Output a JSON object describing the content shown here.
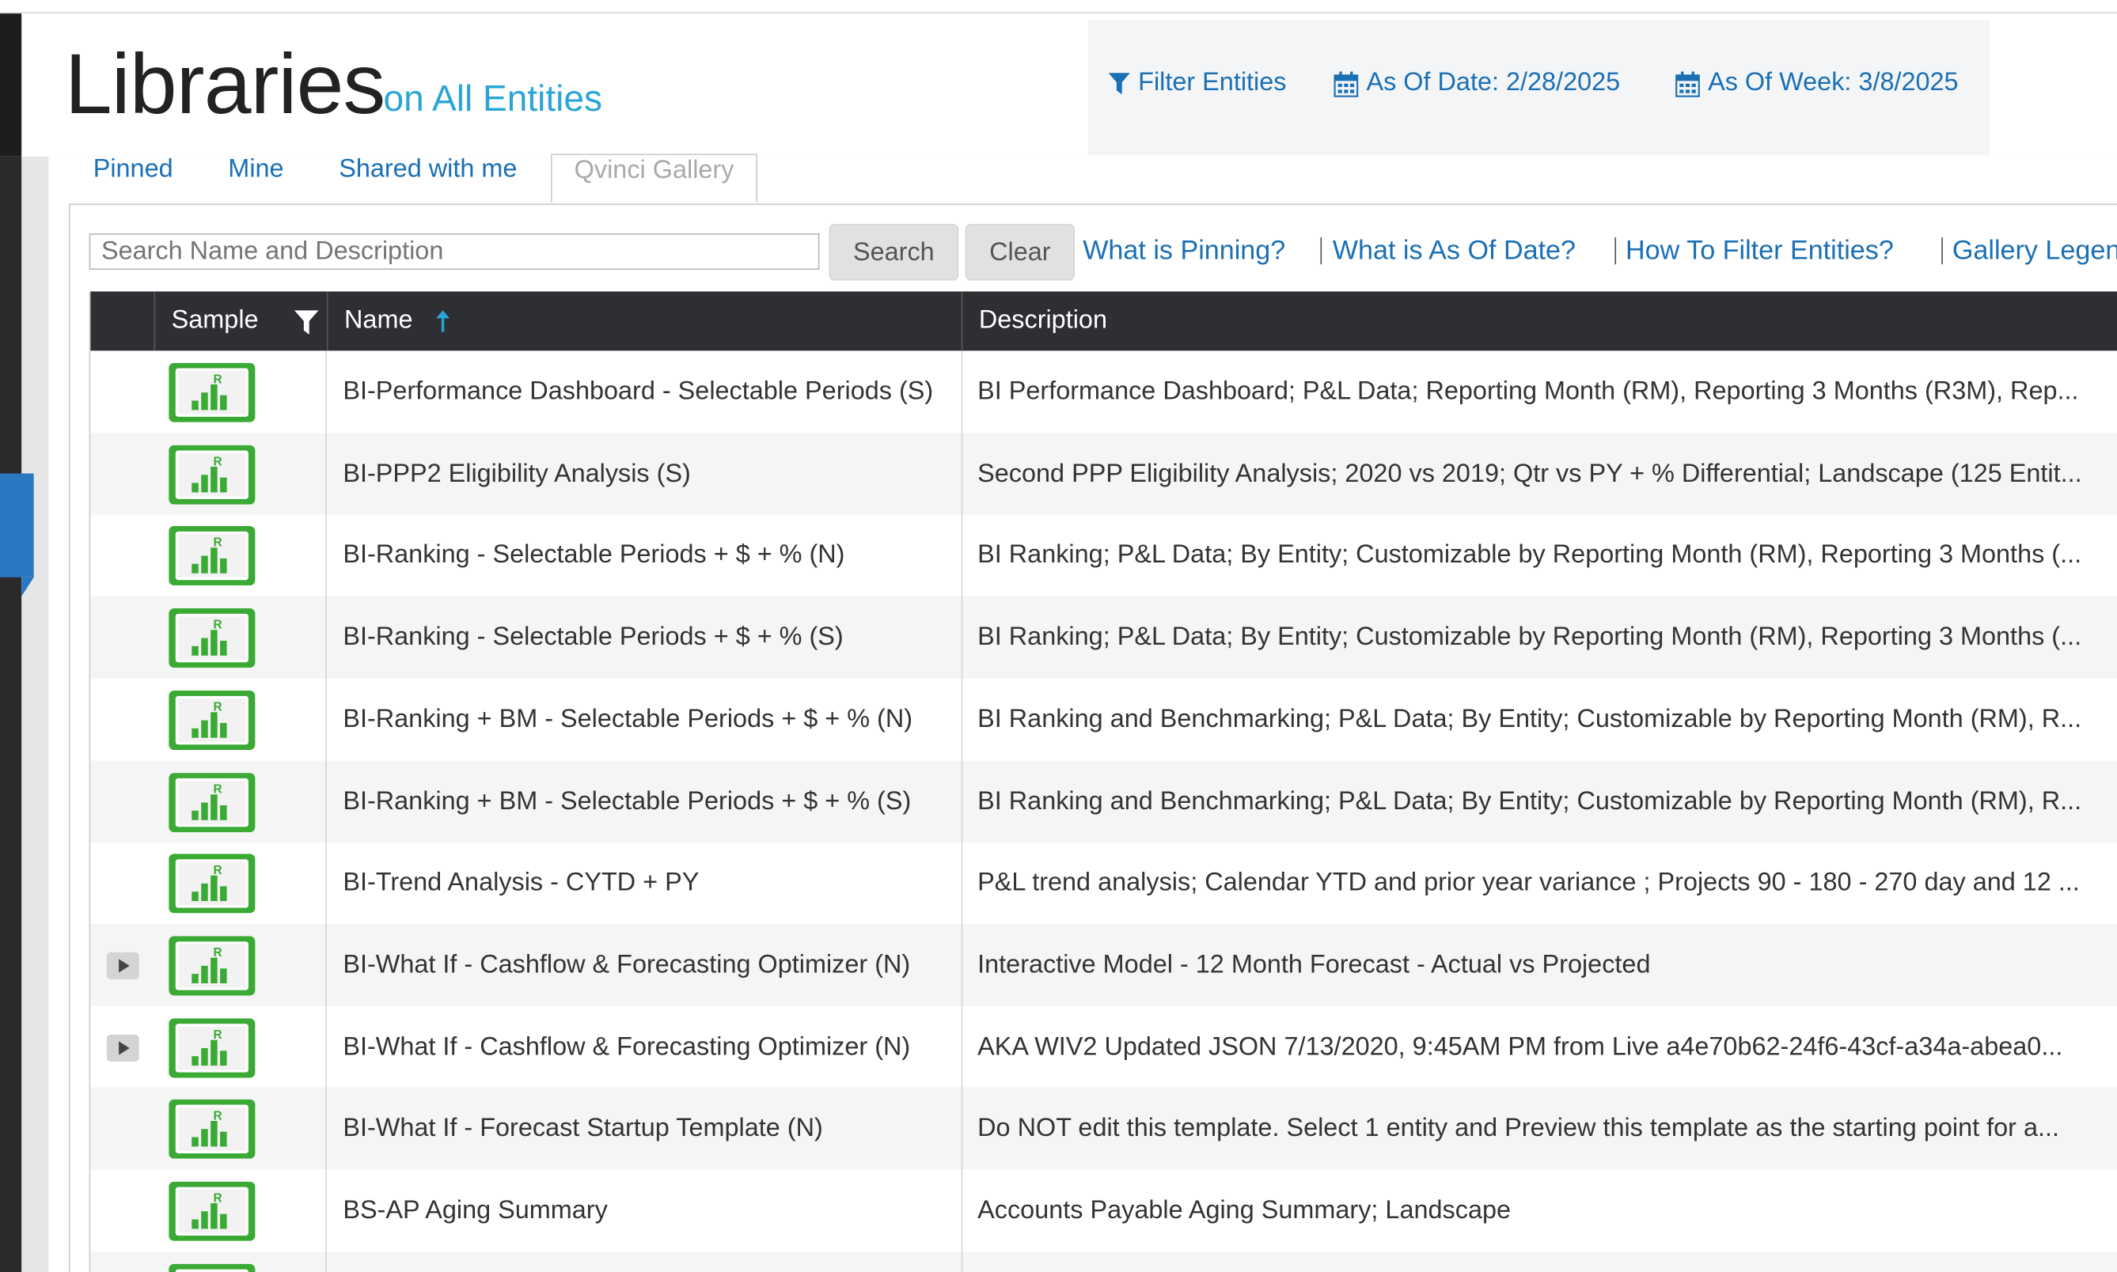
{
  "header": {
    "title": "Libraries",
    "subtitle": "on All Entities",
    "filter_entities": "Filter Entities",
    "as_of_date": "As Of Date: 2/28/2025",
    "as_of_week": "As Of Week: 3/8/2025"
  },
  "tabs": {
    "pinned": "Pinned",
    "mine": "Mine",
    "shared": "Shared with me",
    "gallery": "Qvinci Gallery"
  },
  "search": {
    "placeholder": "Search Name and Description",
    "search_label": "Search",
    "clear_label": "Clear"
  },
  "help_links": {
    "pinning": "What is Pinning?",
    "as_of": "What is As Of Date?",
    "filter": "How To Filter Entities?",
    "legend": "Gallery Legend"
  },
  "grid": {
    "col_sample": "Sample",
    "col_name": "Name",
    "col_description": "Description",
    "rows": [
      {
        "name": "BI-Performance Dashboard - Selectable Periods (S)",
        "description": "BI Performance Dashboard; P&L Data; Reporting Month (RM), Reporting 3 Months (R3M), Rep...",
        "expandable": false
      },
      {
        "name": "BI-PPP2 Eligibility Analysis (S)",
        "description": "Second PPP Eligibility Analysis; 2020 vs 2019; Qtr vs PY + % Differential; Landscape (125 Entit...",
        "expandable": false
      },
      {
        "name": "BI-Ranking - Selectable Periods + $ + % (N)",
        "description": "BI Ranking; P&L Data; By Entity; Customizable by Reporting Month (RM), Reporting 3 Months (...",
        "expandable": false
      },
      {
        "name": "BI-Ranking - Selectable Periods + $ + % (S)",
        "description": "BI Ranking; P&L Data; By Entity; Customizable by Reporting Month (RM), Reporting 3 Months (...",
        "expandable": false
      },
      {
        "name": "BI-Ranking + BM - Selectable Periods + $ + % (N)",
        "description": "BI Ranking and Benchmarking; P&L Data; By Entity; Customizable by Reporting Month (RM), R...",
        "expandable": false
      },
      {
        "name": "BI-Ranking + BM - Selectable Periods + $ + % (S)",
        "description": "BI Ranking and Benchmarking; P&L Data; By Entity; Customizable by Reporting Month (RM), R...",
        "expandable": false
      },
      {
        "name": "BI-Trend Analysis - CYTD + PY",
        "description": "P&L trend analysis; Calendar YTD and prior year variance ; Projects 90 - 180 - 270 day and 12 ...",
        "expandable": false
      },
      {
        "name": "BI-What If - Cashflow & Forecasting Optimizer (N)",
        "description": "Interactive Model - 12 Month Forecast - Actual vs Projected",
        "expandable": true
      },
      {
        "name": "BI-What If - Cashflow & Forecasting Optimizer (N)",
        "description": "AKA WIV2 Updated JSON 7/13/2020, 9:45AM PM from Live a4e70b62-24f6-43cf-a34a-abea0...",
        "expandable": true
      },
      {
        "name": "BI-What If - Forecast Startup Template (N)",
        "description": "Do NOT edit this template. Select 1 entity and Preview this template as the starting point for a...",
        "expandable": false
      },
      {
        "name": "BS-AP Aging Summary",
        "description": "Accounts Payable Aging Summary; Landscape",
        "expandable": false
      },
      {
        "name": "",
        "description": "",
        "expandable": false
      }
    ]
  },
  "colors": {
    "link": "#1a6fb5",
    "subtitle": "#2aa5d6",
    "grid_header": "#2d2f33",
    "thumb_green": "#3aaa35"
  },
  "icons": [
    "funnel-icon",
    "calendar-icon",
    "sort-up-arrow-icon",
    "report-thumbnail-icon",
    "expand-triangle-icon"
  ]
}
